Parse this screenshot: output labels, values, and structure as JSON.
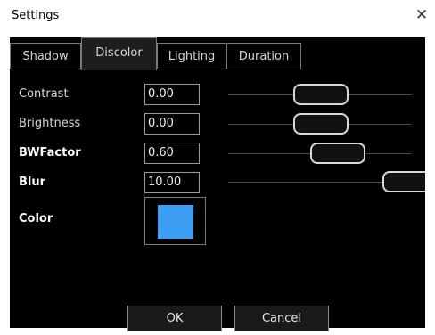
{
  "window": {
    "title": "Settings",
    "close_symbol": "✕"
  },
  "tabs": [
    {
      "label": "Shadow",
      "active": false
    },
    {
      "label": "Discolor",
      "active": true
    },
    {
      "label": "Lighting",
      "active": false
    },
    {
      "label": "Duration",
      "active": false
    }
  ],
  "settings": {
    "contrast": {
      "label": "Contrast",
      "value": "0.00"
    },
    "brightness": {
      "label": "Brightness",
      "value": "0.00"
    },
    "bwfactor": {
      "label": "BWFactor",
      "value": "0.60"
    },
    "blur": {
      "label": "Blur",
      "value": "10.00"
    },
    "color": {
      "label": "Color",
      "swatch": "#3d9df2"
    }
  },
  "buttons": {
    "ok": "OK",
    "cancel": "Cancel"
  }
}
